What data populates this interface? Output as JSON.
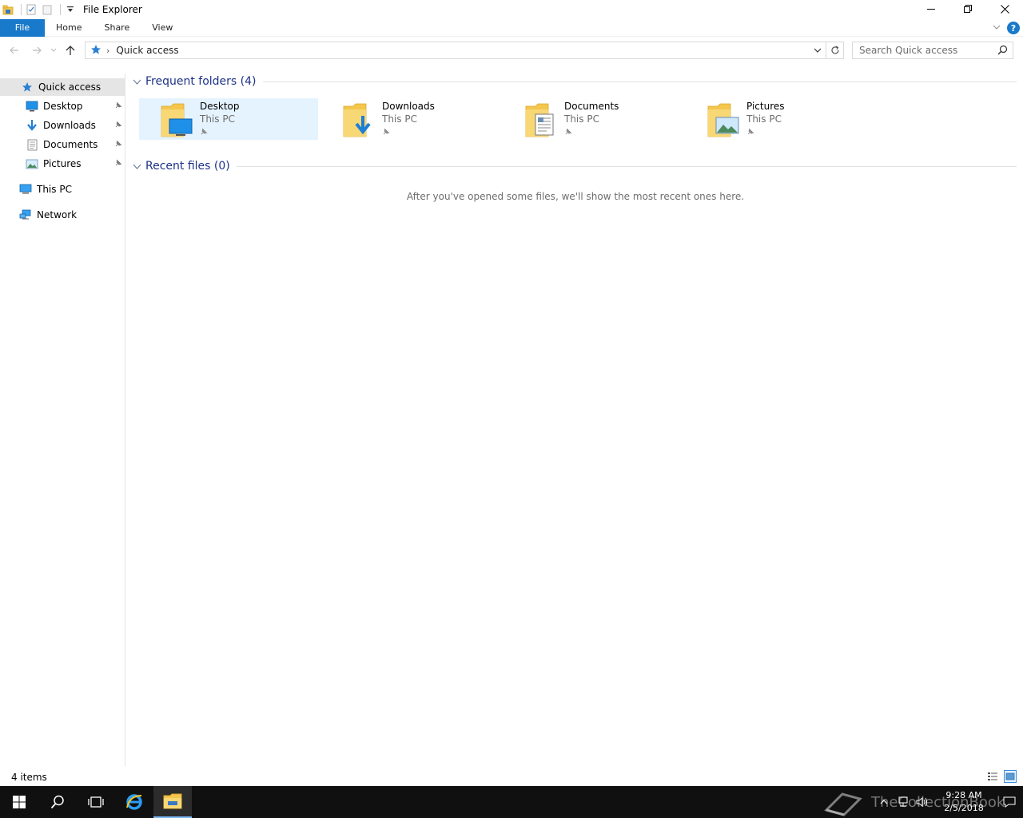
{
  "window": {
    "title": "File Explorer"
  },
  "ribbon": {
    "tabs": [
      {
        "label": "File"
      },
      {
        "label": "Home"
      },
      {
        "label": "Share"
      },
      {
        "label": "View"
      }
    ],
    "help_label": "?"
  },
  "address": {
    "crumb": "Quick access",
    "separator": "›"
  },
  "search": {
    "placeholder": "Search Quick access"
  },
  "navpane": {
    "quick_access": "Quick access",
    "items": [
      {
        "label": "Desktop",
        "icon": "desktop-icon",
        "pinned": true
      },
      {
        "label": "Downloads",
        "icon": "downloads-icon",
        "pinned": true
      },
      {
        "label": "Documents",
        "icon": "documents-icon",
        "pinned": true
      },
      {
        "label": "Pictures",
        "icon": "pictures-icon",
        "pinned": true
      }
    ],
    "this_pc": "This PC",
    "network": "Network"
  },
  "content": {
    "frequent_header": "Frequent folders (4)",
    "recent_header": "Recent files (0)",
    "empty_message": "After you've opened some files, we'll show the most recent ones here.",
    "folders": [
      {
        "name": "Desktop",
        "location": "This PC"
      },
      {
        "name": "Downloads",
        "location": "This PC"
      },
      {
        "name": "Documents",
        "location": "This PC"
      },
      {
        "name": "Pictures",
        "location": "This PC"
      }
    ]
  },
  "status": {
    "item_count": "4 items"
  },
  "taskbar": {
    "time": "9:28 AM",
    "date": "2/5/2018",
    "watermark": "TheCollectionBook"
  },
  "colors": {
    "accent": "#1979ca",
    "header_text": "#1e3287",
    "selection": "#e5f3ff",
    "taskbar": "#101010"
  }
}
